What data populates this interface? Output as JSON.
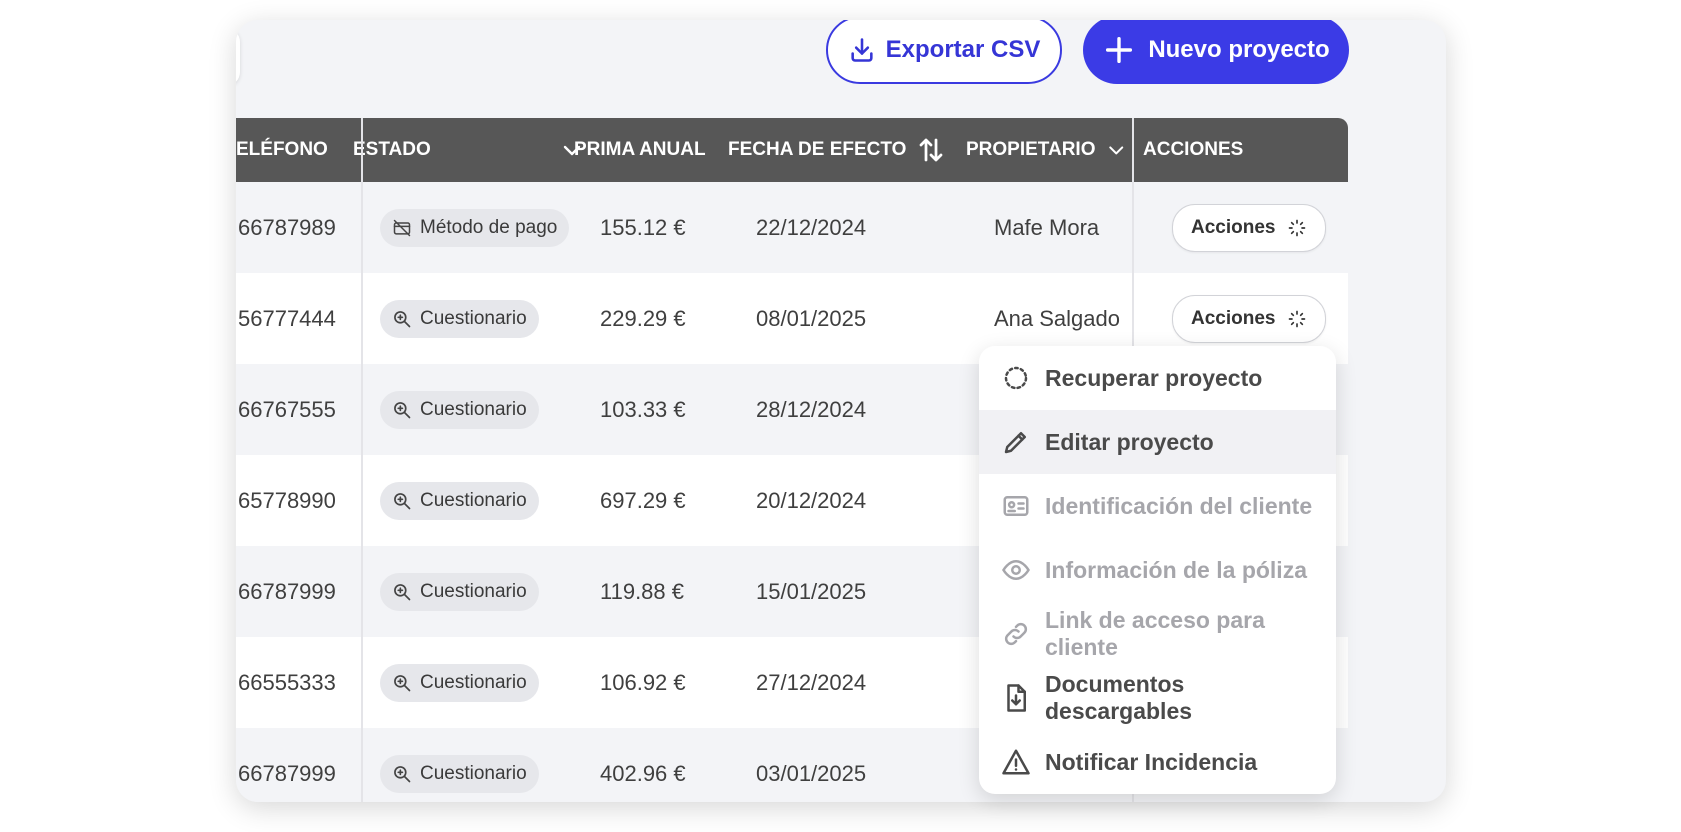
{
  "toolbar": {
    "export_label": "Exportar CSV",
    "new_label": "Nuevo proyecto"
  },
  "table": {
    "columns": {
      "telefono": "ELÉFONO",
      "estado": "ESTADO",
      "prima": "PRIMA ANUAL",
      "fecha": "FECHA DE EFECTO",
      "propietario": "PROPIETARIO",
      "acciones": "ACCIONES"
    },
    "rows": [
      {
        "telefono": "66787989",
        "estado": "Método de pago",
        "prima": "155.12 €",
        "fecha": "22/12/2024",
        "propietario": "Mafe Mora",
        "accion": "Acciones"
      },
      {
        "telefono": "56777444",
        "estado": "Cuestionario",
        "prima": "229.29 €",
        "fecha": "08/01/2025",
        "propietario": "Ana Salgado",
        "accion": "Acciones"
      },
      {
        "telefono": "66767555",
        "estado": "Cuestionario",
        "prima": "103.33 €",
        "fecha": "28/12/2024"
      },
      {
        "telefono": "65778990",
        "estado": "Cuestionario",
        "prima": "697.29 €",
        "fecha": "20/12/2024"
      },
      {
        "telefono": "66787999",
        "estado": "Cuestionario",
        "prima": "119.88 €",
        "fecha": "15/01/2025"
      },
      {
        "telefono": "66555333",
        "estado": "Cuestionario",
        "prima": "106.92 €",
        "fecha": "27/12/2024"
      },
      {
        "telefono": "66787999",
        "estado": "Cuestionario",
        "prima": "402.96 €",
        "fecha": "03/01/2025"
      }
    ]
  },
  "menu": {
    "items": [
      {
        "label": "Recuperar proyecto",
        "icon": "restore-icon",
        "disabled": false
      },
      {
        "label": "Editar proyecto",
        "icon": "pencil-icon",
        "disabled": false,
        "hovered": true
      },
      {
        "label": "Identificación del cliente",
        "icon": "id-card-icon",
        "disabled": true
      },
      {
        "label": "Información de la póliza",
        "icon": "eye-icon",
        "disabled": true
      },
      {
        "label": "Link de acceso para cliente",
        "icon": "link-icon",
        "disabled": true
      },
      {
        "label": "Documentos descargables",
        "icon": "download-document-icon",
        "disabled": false
      },
      {
        "label": "Notificar Incidencia",
        "icon": "warning-icon",
        "disabled": false
      }
    ]
  },
  "colors": {
    "primary": "#3b3be6",
    "header_bg": "#575757",
    "page_bg": "#f3f4f7"
  }
}
